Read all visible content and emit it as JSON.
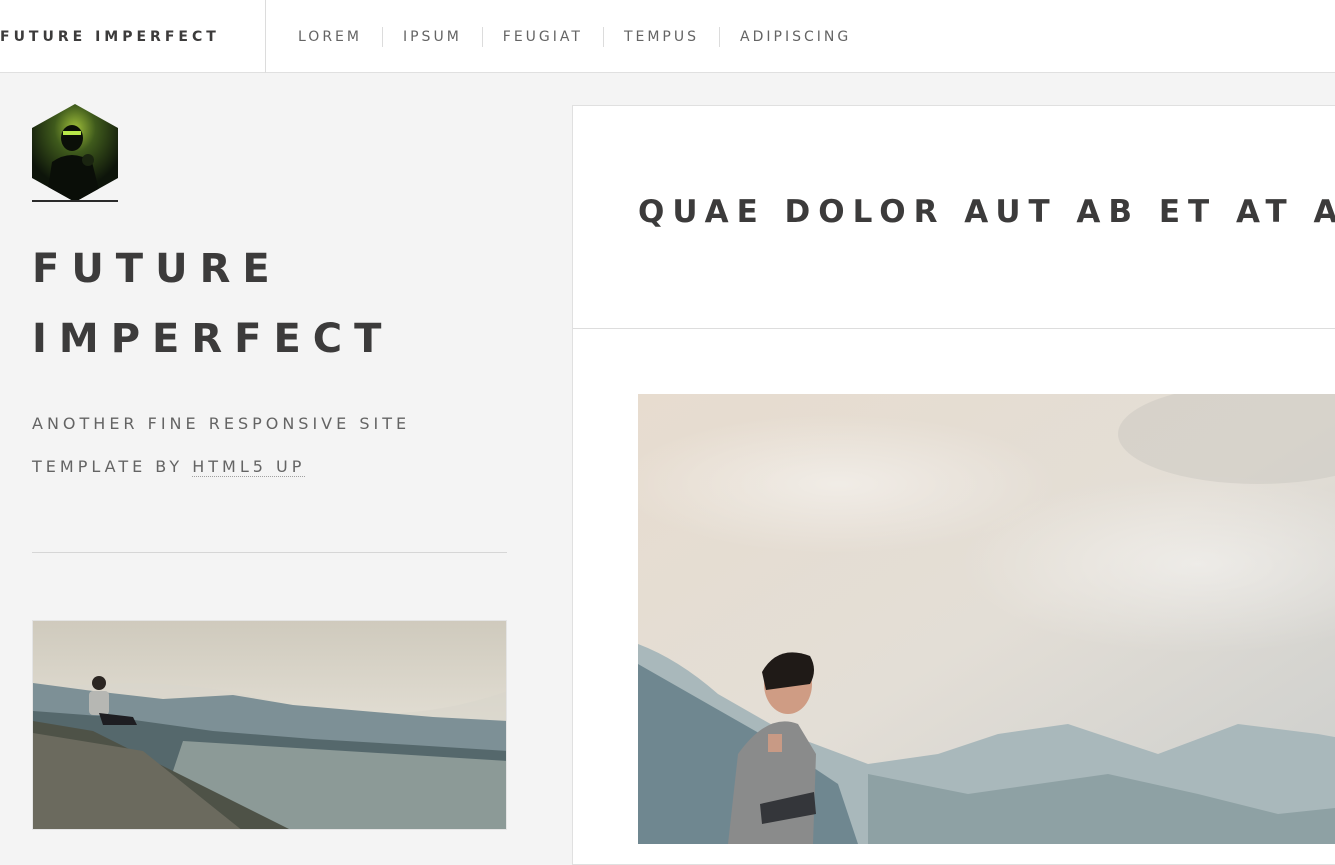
{
  "header": {
    "brand": "FUTURE IMPERFECT",
    "nav": [
      "LOREM",
      "IPSUM",
      "FEUGIAT",
      "TEMPUS",
      "ADIPISCING"
    ]
  },
  "sidebar": {
    "title_line1": "FUTURE",
    "title_line2": "IMPERFECT",
    "subtitle_line1": "ANOTHER FINE RESPONSIVE SITE",
    "subtitle_line2_prefix": "TEMPLATE BY ",
    "subtitle_link": "HTML5 UP"
  },
  "post": {
    "title": "QUAE DOLOR AUT AB ET AT AT"
  },
  "icons": {
    "avatar": "hexagon-avatar-icon"
  }
}
